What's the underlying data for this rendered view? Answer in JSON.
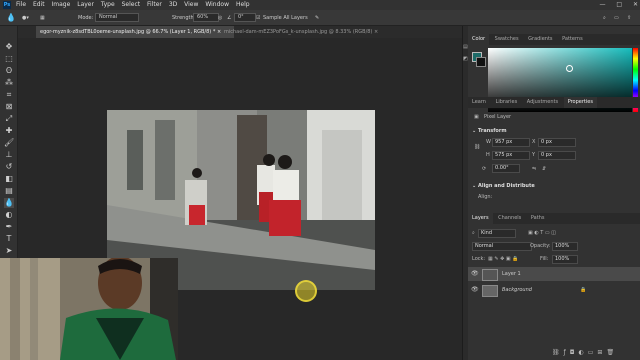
{
  "app": {
    "logo": "Ps"
  },
  "menu": [
    "File",
    "Edit",
    "Image",
    "Layer",
    "Type",
    "Select",
    "Filter",
    "3D",
    "View",
    "Window",
    "Help"
  ],
  "window_controls": [
    "—",
    "□",
    "✕"
  ],
  "options_bar": {
    "mode_label": "Mode:",
    "mode_value": "Normal",
    "strength_label": "Strength:",
    "strength_value": "60%",
    "angle_value": "0°",
    "sample_all": "Sample All Layers"
  },
  "tabs": [
    {
      "label": "egor-myznik-z8sdTBL0oeme-unsplash.jpg @ 66.7% (Layer 1, RGB/8) *",
      "close": "×"
    },
    {
      "label": "michael-dam-mEZ3PoFGs_k-unsplash.jpg @ 8.33% (RGB/8)",
      "close": "×"
    }
  ],
  "color_panel": {
    "tabs": [
      "Color",
      "Swatches",
      "Gradients",
      "Patterns"
    ]
  },
  "props_panel": {
    "tabs": [
      "Learn",
      "Libraries",
      "Adjustments",
      "Properties"
    ],
    "layer_type": "Pixel Layer",
    "transform_header": "Transform",
    "w_label": "W",
    "w_value": "957 px",
    "h_label": "H",
    "h_value": "575 px",
    "x_label": "X",
    "x_value": "0 px",
    "y_label": "Y",
    "y_value": "0 px",
    "angle_value": "0.00°",
    "align_header": "Align and Distribute",
    "align_label": "Align:"
  },
  "layers_panel": {
    "tabs": [
      "Layers",
      "Channels",
      "Paths"
    ],
    "kind_value": "Kind",
    "blend_value": "Normal",
    "opacity_label": "Opacity:",
    "opacity_value": "100%",
    "lock_label": "Lock:",
    "fill_label": "Fill:",
    "fill_value": "100%",
    "layers": [
      "Layer 1",
      "Background"
    ]
  },
  "colors": {
    "fg": "#1d6b68",
    "bg": "#111111",
    "accent": "#31a8ff",
    "picker_hue": "#16bcbc"
  }
}
